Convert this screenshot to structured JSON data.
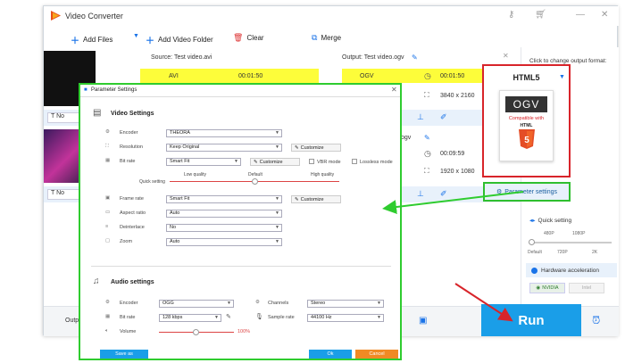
{
  "window": {
    "title": "Video Converter"
  },
  "toolbar": {
    "add_files": "Add Files",
    "add_video_folder": "Add Video Folder",
    "clear": "Clear",
    "merge": "Merge"
  },
  "file1": {
    "source": "Source: Test video.avi",
    "output": "Output: Test video.ogv",
    "src_format": "AVI",
    "src_duration": "00:01:50",
    "out_format": "OGV",
    "out_duration": "00:01:50",
    "out_resolution": "3840 x 2160",
    "subtitle_label": "No"
  },
  "file2": {
    "out_ext": ".ogv",
    "out_duration": "00:09:59",
    "out_resolution": "1920 x 1080",
    "subtitle_label": "No"
  },
  "right_panel": {
    "hint": "Click to change output format:",
    "format_group": "HTML5",
    "tile_format": "OGV",
    "tile_compat": "Compatible with",
    "tile_html": "HTML",
    "param_button": "Parameter settings",
    "quick_setting": "Quick setting",
    "quick_labels_top": [
      "480P",
      "1080P"
    ],
    "quick_labels_bottom": [
      "Default",
      "720P",
      "2K"
    ],
    "hw_accel": "Hardware acceleration",
    "nvidia": "NVIDIA",
    "intel": "Intel"
  },
  "bottom": {
    "output_label": "Outp",
    "run": "Run"
  },
  "dialog": {
    "title": "Parameter Settings",
    "video_settings": "Video Settings",
    "encoder_label": "Encoder",
    "encoder_value": "THEORA",
    "resolution_label": "Resolution",
    "resolution_value": "Keep Original",
    "customize": "Customize",
    "bitrate_label": "Bit rate",
    "bitrate_value": "Smart Fit",
    "vbr_mode": "VBR mode",
    "lossless_mode": "Lossless mode",
    "low_quality": "Low quality",
    "default": "Default",
    "high_quality": "High quality",
    "quick_setting": "Quick setting",
    "framerate_label": "Frame rate",
    "framerate_value": "Smart Fit",
    "aspect_label": "Aspect ratio",
    "aspect_value": "Auto",
    "deinterlace_label": "Deinterlace",
    "deinterlace_value": "No",
    "zoom_label": "Zoom",
    "zoom_value": "Auto",
    "audio_settings": "Audio settings",
    "a_encoder_label": "Encoder",
    "a_encoder_value": "OGG",
    "channels_label": "Channels",
    "channels_value": "Stereo",
    "a_bitrate_label": "Bit rate",
    "a_bitrate_value": "128 kbps",
    "sample_rate_label": "Sample rate",
    "sample_rate_value": "44100 Hz",
    "volume_label": "Volume",
    "volume_value": "100%",
    "save_as": "Save as",
    "ok": "Ok",
    "cancel": "Cancel"
  },
  "colors": {
    "accent": "#1a9ee8",
    "highlight_red": "#d8242a",
    "highlight_green": "#2fcc2f",
    "row_yellow": "#fdfd3a"
  }
}
